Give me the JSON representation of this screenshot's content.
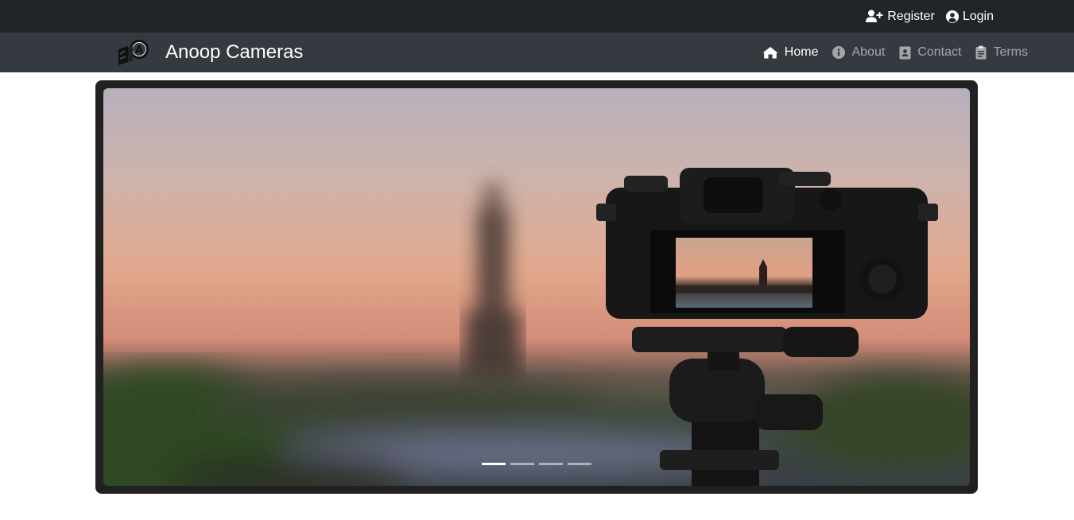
{
  "topbar": {
    "register_label": "Register",
    "login_label": "Login"
  },
  "navbar": {
    "brand_title": "Anoop Cameras",
    "items": [
      {
        "label": "Home",
        "icon": "home-icon",
        "active": true
      },
      {
        "label": "About",
        "icon": "info-icon",
        "active": false
      },
      {
        "label": "Contact",
        "icon": "contact-book-icon",
        "active": false
      },
      {
        "label": "Terms",
        "icon": "clipboard-icon",
        "active": false
      }
    ]
  },
  "carousel": {
    "slide_count": 4,
    "active_slide": 1,
    "slide_image": "camera-on-tripod-at-sunset"
  },
  "colors": {
    "topbar_bg": "#212529",
    "navbar_bg": "#343a40",
    "frame_bg": "#212121"
  }
}
